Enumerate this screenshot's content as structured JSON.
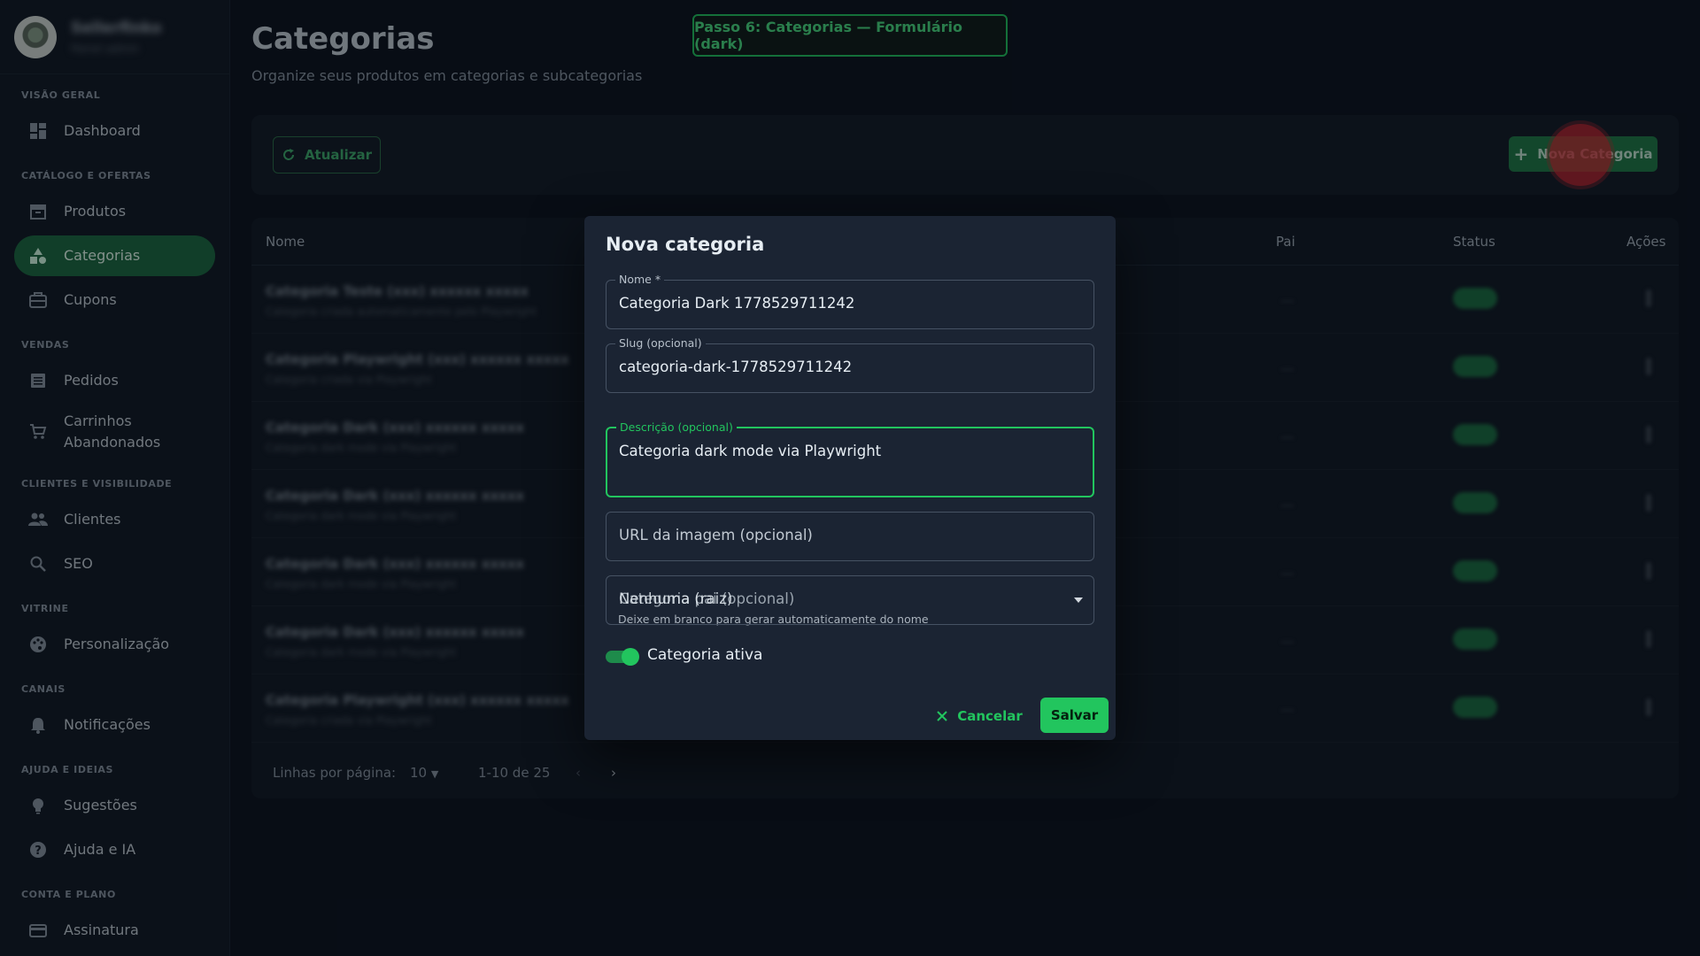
{
  "sidebar": {
    "profile": {
      "name": "Sellerfinko",
      "subtitle": "Painel admin"
    },
    "sections": [
      {
        "title": "VISÃO GERAL",
        "items": [
          {
            "label": "Dashboard",
            "icon": "dashboard-icon"
          }
        ]
      },
      {
        "title": "CATÁLOGO E OFERTAS",
        "items": [
          {
            "label": "Produtos",
            "icon": "box-icon"
          },
          {
            "label": "Categorias",
            "icon": "category-icon",
            "active": true
          },
          {
            "label": "Cupons",
            "icon": "ticket-icon"
          }
        ]
      },
      {
        "title": "VENDAS",
        "items": [
          {
            "label": "Pedidos",
            "icon": "orders-icon"
          },
          {
            "label": "Carrinhos Abandonados",
            "icon": "cart-icon"
          }
        ]
      },
      {
        "title": "CLIENTES E VISIBILIDADE",
        "items": [
          {
            "label": "Clientes",
            "icon": "people-icon"
          },
          {
            "label": "SEO",
            "icon": "search-icon"
          }
        ]
      },
      {
        "title": "VITRINE",
        "items": [
          {
            "label": "Personalização",
            "icon": "palette-icon"
          }
        ]
      },
      {
        "title": "CANAIS",
        "items": [
          {
            "label": "Notificações",
            "icon": "bell-icon"
          }
        ]
      },
      {
        "title": "AJUDA E IDEIAS",
        "items": [
          {
            "label": "Sugestões",
            "icon": "lightbulb-icon"
          },
          {
            "label": "Ajuda e IA",
            "icon": "help-icon"
          }
        ]
      },
      {
        "title": "CONTA E PLANO",
        "items": [
          {
            "label": "Assinatura",
            "icon": "card-icon"
          }
        ]
      }
    ]
  },
  "page": {
    "title": "Categorias",
    "subtitle": "Organize seus produtos em categorias e subcategorias",
    "step_banner": "Passo 6: Categorias — Formulário (dark)"
  },
  "toolbar": {
    "refresh_label": "Atualizar",
    "new_label": "Nova Categoria"
  },
  "table": {
    "headers": {
      "name": "Nome",
      "parent": "Pai",
      "status": "Status",
      "actions": "Ações"
    },
    "rows": [
      {
        "name": "Categoria Teste (xxx) xxxxxx xxxxx",
        "desc": "Categoria criada automaticamente pelo Playwright"
      },
      {
        "name": "Categoria Playwright (xxx) xxxxxx xxxxx",
        "desc": "Categoria criada via Playwright"
      },
      {
        "name": "Categoria Dark (xxx) xxxxxx xxxxx",
        "desc": "Categoria dark mode via Playwright"
      },
      {
        "name": "Categoria Dark (xxx) xxxxxx xxxxx",
        "desc": "Categoria dark mode via Playwright"
      },
      {
        "name": "Categoria Dark (xxx) xxxxxx xxxxx",
        "desc": "Categoria dark mode via Playwright"
      },
      {
        "name": "Categoria Dark (xxx) xxxxxx xxxxx",
        "desc": "Categoria dark mode via Playwright"
      },
      {
        "name": "Categoria Playwright (xxx) xxxxxx xxxxx",
        "desc": "Categoria criada via Playwright"
      }
    ],
    "pager": {
      "rows_label": "Linhas por página:",
      "rows_value": "10",
      "range": "1-10 de 25"
    }
  },
  "dialog": {
    "title": "Nova categoria",
    "name_label": "Nome *",
    "name_value": "Categoria Dark 1778529711242",
    "slug_label": "Slug (opcional)",
    "slug_value": "categoria-dark-1778529711242",
    "slug_helper": "Deixe em branco para gerar automaticamente do nome",
    "desc_label": "Descrição (opcional)",
    "desc_value": "Categoria dark mode via Playwright",
    "image_placeholder": "URL da imagem (opcional)",
    "parent_placeholder": "Categoria pai (opcional)",
    "parent_value": "Nenhuma (raiz)",
    "active_label": "Categoria ativa",
    "active": true,
    "cancel_label": "Cancelar",
    "save_label": "Salvar"
  },
  "colors": {
    "accent": "#22c55e",
    "active_nav": "#1c6b40",
    "background": "#0b111c"
  }
}
